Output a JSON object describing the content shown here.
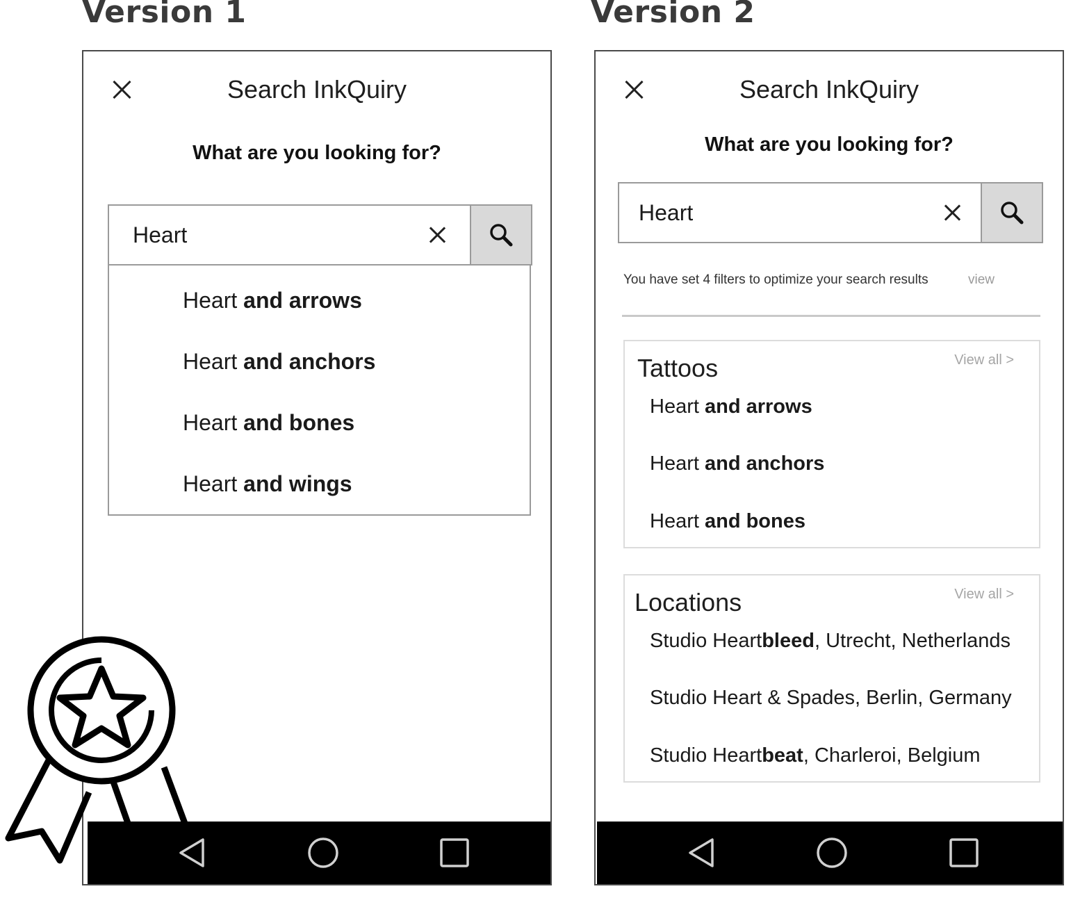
{
  "versions": [
    {
      "title": "Version 1",
      "screen_title": "Search InkQuiry",
      "prompt": "What are you looking for?",
      "search": {
        "value": "Heart"
      },
      "suggestions": [
        {
          "prefix": "Heart",
          "rest": " and arrows"
        },
        {
          "prefix": "Heart",
          "rest": " and anchors"
        },
        {
          "prefix": "Heart",
          "rest": " and bones"
        },
        {
          "prefix": "Heart",
          "rest": " and wings"
        }
      ]
    },
    {
      "title": "Version 2",
      "screen_title": "Search InkQuiry",
      "prompt": "What are you looking for?",
      "search": {
        "value": "Heart"
      },
      "filter_note": "You have set 4 filters to optimize your search results",
      "filter_view_label": "view",
      "groups": [
        {
          "title": "Tattoos",
          "view_all": "View all >",
          "items": [
            {
              "a": "Heart",
              "b": " and arrows",
              "c": ""
            },
            {
              "a": "Heart",
              "b": " and anchors",
              "c": ""
            },
            {
              "a": "Heart",
              "b": " and bones",
              "c": ""
            }
          ]
        },
        {
          "title": "Locations",
          "view_all": "View all >",
          "items": [
            {
              "a": "Studio Heart",
              "b": "bleed",
              "c": ", Utrecht, Netherlands"
            },
            {
              "a": "Studio Heart & Spades, Berlin, Germany",
              "b": "",
              "c": ""
            },
            {
              "a": "Studio Heart",
              "b": "beat",
              "c": ", Charleroi, Belgium"
            }
          ]
        }
      ]
    }
  ],
  "icons": {
    "close": "close-icon",
    "clear": "clear-icon",
    "search": "search-icon",
    "back": "back-triangle-icon",
    "home": "home-circle-icon",
    "recents": "recents-square-icon",
    "badge": "award-ribbon-icon"
  }
}
